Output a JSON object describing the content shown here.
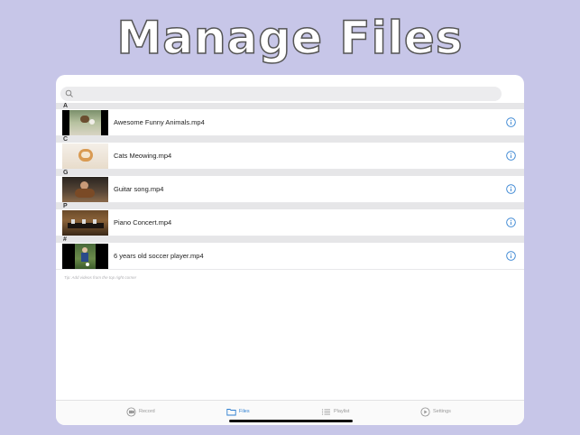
{
  "headline": "Manage Files",
  "search": {
    "placeholder": ""
  },
  "sections": [
    {
      "letter": "A",
      "file": "Awesome Funny Animals.mp4",
      "thumb": "animals"
    },
    {
      "letter": "C",
      "file": "Cats Meowing.mp4",
      "thumb": "cat"
    },
    {
      "letter": "G",
      "file": "Guitar song.mp4",
      "thumb": "guitar"
    },
    {
      "letter": "P",
      "file": "Piano Concert.mp4",
      "thumb": "piano"
    },
    {
      "letter": "#",
      "file": "6 years old soccer player.mp4",
      "thumb": "soccer"
    }
  ],
  "tip": "Tip: Add videos from the top right corner",
  "tabs": [
    {
      "label": "Record",
      "icon": "record-icon",
      "active": false
    },
    {
      "label": "Files",
      "icon": "folder-icon",
      "active": true
    },
    {
      "label": "Playlist",
      "icon": "list-icon",
      "active": false
    },
    {
      "label": "Settings",
      "icon": "gear-icon",
      "active": false
    }
  ],
  "colors": {
    "background": "#c7c6e8",
    "accent": "#2f7fd1"
  }
}
